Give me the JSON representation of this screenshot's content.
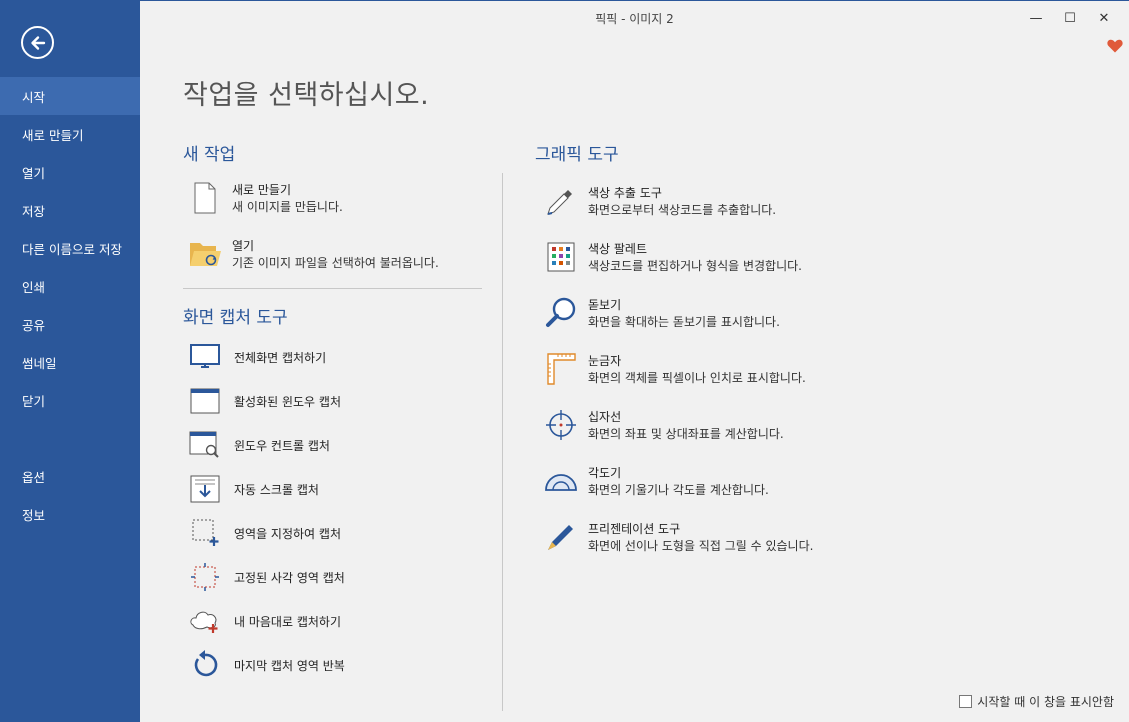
{
  "window": {
    "title": "픽픽 - 이미지 2",
    "minimize": "—",
    "maximize": "☐",
    "close": "✕"
  },
  "sidebar": {
    "items": [
      {
        "label": "시작",
        "active": true
      },
      {
        "label": "새로 만들기"
      },
      {
        "label": "열기"
      },
      {
        "label": "저장"
      },
      {
        "label": "다른 이름으로 저장"
      },
      {
        "label": "인쇄"
      },
      {
        "label": "공유"
      },
      {
        "label": "썸네일"
      },
      {
        "label": "닫기"
      },
      {
        "label": "옵션"
      },
      {
        "label": "정보"
      }
    ]
  },
  "main": {
    "title": "작업을 선택하십시오.",
    "new_task": {
      "heading": "새 작업",
      "items": [
        {
          "name": "새로 만들기",
          "desc": "새 이미지를 만듭니다.",
          "icon": "new-file-icon"
        },
        {
          "name": "열기",
          "desc": "기존 이미지 파일을 선택하여 불러옵니다.",
          "icon": "open-folder-icon"
        }
      ]
    },
    "capture": {
      "heading": "화면 캡처 도구",
      "items": [
        {
          "name": "전체화면 캡처하기",
          "icon": "monitor-icon"
        },
        {
          "name": "활성화된 윈도우 캡처",
          "icon": "active-window-icon"
        },
        {
          "name": "윈도우 컨트롤 캡처",
          "icon": "window-control-icon"
        },
        {
          "name": "자동 스크롤 캡처",
          "icon": "scroll-capture-icon"
        },
        {
          "name": "영역을 지정하여 캡처",
          "icon": "region-select-icon"
        },
        {
          "name": "고정된 사각 영역 캡처",
          "icon": "fixed-region-icon"
        },
        {
          "name": "내 마음대로 캡처하기",
          "icon": "freehand-icon"
        },
        {
          "name": "마지막 캡처 영역 반복",
          "icon": "repeat-icon"
        }
      ]
    },
    "graphic_tools": {
      "heading": "그래픽 도구",
      "items": [
        {
          "name": "색상 추출 도구",
          "desc": "화면으로부터 색상코드를 추출합니다.",
          "icon": "eyedropper-icon"
        },
        {
          "name": "색상 팔레트",
          "desc": "색상코드를 편집하거나 형식을 변경합니다.",
          "icon": "palette-icon"
        },
        {
          "name": "돋보기",
          "desc": "화면을 확대하는 돋보기를 표시합니다.",
          "icon": "magnifier-icon"
        },
        {
          "name": "눈금자",
          "desc": "화면의 객체를 픽셀이나 인치로 표시합니다.",
          "icon": "ruler-icon"
        },
        {
          "name": "십자선",
          "desc": "화면의 좌표 및 상대좌표를 계산합니다.",
          "icon": "crosshair-icon"
        },
        {
          "name": "각도기",
          "desc": "화면의 기울기나 각도를 계산합니다.",
          "icon": "protractor-icon"
        },
        {
          "name": "프리젠테이션 도구",
          "desc": "화면에 선이나 도형을 직접 그릴 수 있습니다.",
          "icon": "pen-icon"
        }
      ]
    },
    "startup_checkbox": "시작할 때 이 창을 표시안함"
  },
  "colors": {
    "sidebar": "#2b579a",
    "sidebar_active": "#3d6bb0",
    "accent": "#2b579a",
    "heart": "#e05a3a"
  }
}
